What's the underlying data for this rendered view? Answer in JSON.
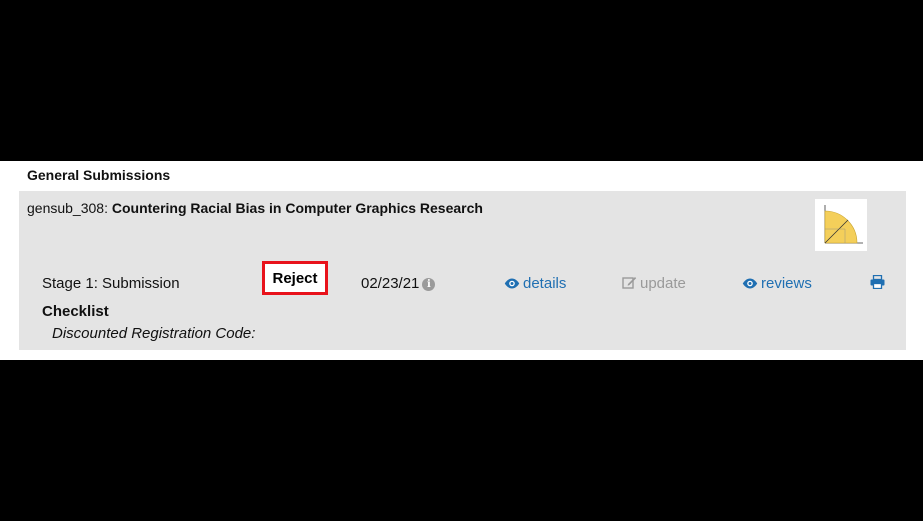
{
  "section": {
    "title": "General Submissions"
  },
  "submission": {
    "id_prefix": "gensub_308:",
    "title": "Countering Racial Bias in Computer Graphics Research",
    "stage": "Stage 1: Submission",
    "decision": "Reject",
    "date": "02/23/21",
    "actions": {
      "details": "details",
      "update": "update",
      "reviews": "reviews"
    },
    "checklist_label": "Checklist",
    "discount_label": "Discounted Registration Code:"
  },
  "icons": {
    "info": "info-icon",
    "eye": "eye-icon",
    "edit": "edit-icon",
    "print": "printer-icon"
  },
  "colors": {
    "link": "#1f6fb2",
    "disabled": "#9a9a9a",
    "highlight": "#e8121b",
    "card_bg": "#e4e4e4"
  }
}
